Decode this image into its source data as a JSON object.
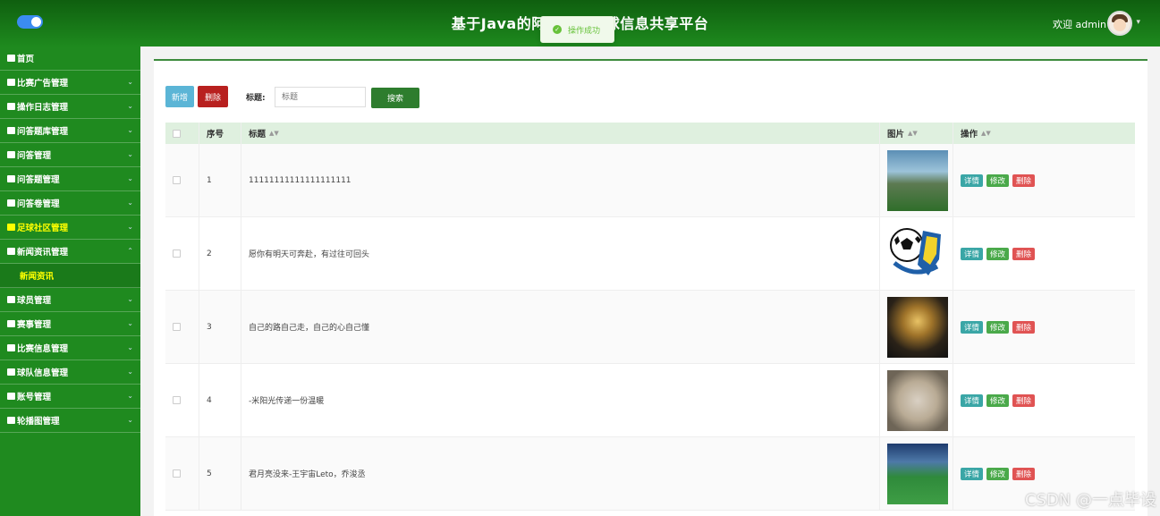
{
  "header": {
    "title": "基于Java的阿图什杯足球信息共享平台",
    "welcome": "欢迎 admin",
    "toast": "操作成功"
  },
  "sidebar": {
    "items": [
      {
        "label": "首页",
        "icon": "home-icon",
        "has_children": false
      },
      {
        "label": "比赛广告管理",
        "icon": "folder-icon",
        "has_children": true
      },
      {
        "label": "操作日志管理",
        "icon": "bar-icon",
        "has_children": true
      },
      {
        "label": "问答题库管理",
        "icon": "doc-icon",
        "has_children": true
      },
      {
        "label": "问答管理",
        "icon": "doc-icon",
        "has_children": true
      },
      {
        "label": "问答题管理",
        "icon": "doc-icon",
        "has_children": true
      },
      {
        "label": "问答卷管理",
        "icon": "shield-icon",
        "has_children": true
      },
      {
        "label": "足球社区管理",
        "icon": "folder-icon",
        "has_children": true,
        "active": true
      },
      {
        "label": "新闻资讯管理",
        "icon": "folder-icon",
        "has_children": true,
        "expanded": true
      },
      {
        "label": "球员管理",
        "icon": "shield-icon",
        "has_children": true
      },
      {
        "label": "赛事管理",
        "icon": "calendar-icon",
        "has_children": true
      },
      {
        "label": "比赛信息管理",
        "icon": "folder-icon",
        "has_children": true
      },
      {
        "label": "球队信息管理",
        "icon": "folder-icon",
        "has_children": true
      },
      {
        "label": "账号管理",
        "icon": "user-icon",
        "has_children": true
      },
      {
        "label": "轮播图管理",
        "icon": "image-icon",
        "has_children": true
      }
    ],
    "sub_item": "新闻资讯"
  },
  "toolbar": {
    "add_label": "新增",
    "delete_label": "删除",
    "search_label": "标题:",
    "search_placeholder": "标题",
    "search_button": "搜索"
  },
  "table": {
    "headers": {
      "num": "序号",
      "title": "标题",
      "image": "图片",
      "ops": "操作"
    },
    "rows": [
      {
        "num": "1",
        "title": "11111111111111111111"
      },
      {
        "num": "2",
        "title": "愿你有明天可奔赴，有过往可回头"
      },
      {
        "num": "3",
        "title": "自己的路自己走，自己的心自己懂"
      },
      {
        "num": "4",
        "title": "-米阳光传递一份温暖"
      },
      {
        "num": "5",
        "title": "君月亮没来-王宇宙Leto，乔浚丞"
      }
    ],
    "ops": {
      "detail": "详情",
      "edit": "修改",
      "delete": "删除"
    }
  },
  "watermark": "CSDN @一点毕设",
  "colors": {
    "header_dark": "#0f5f0f",
    "sidebar": "#1f8a1f",
    "active": "#ffff00",
    "add": "#5bb5d6",
    "delete": "#b8201f",
    "search": "#2e7d2e"
  }
}
